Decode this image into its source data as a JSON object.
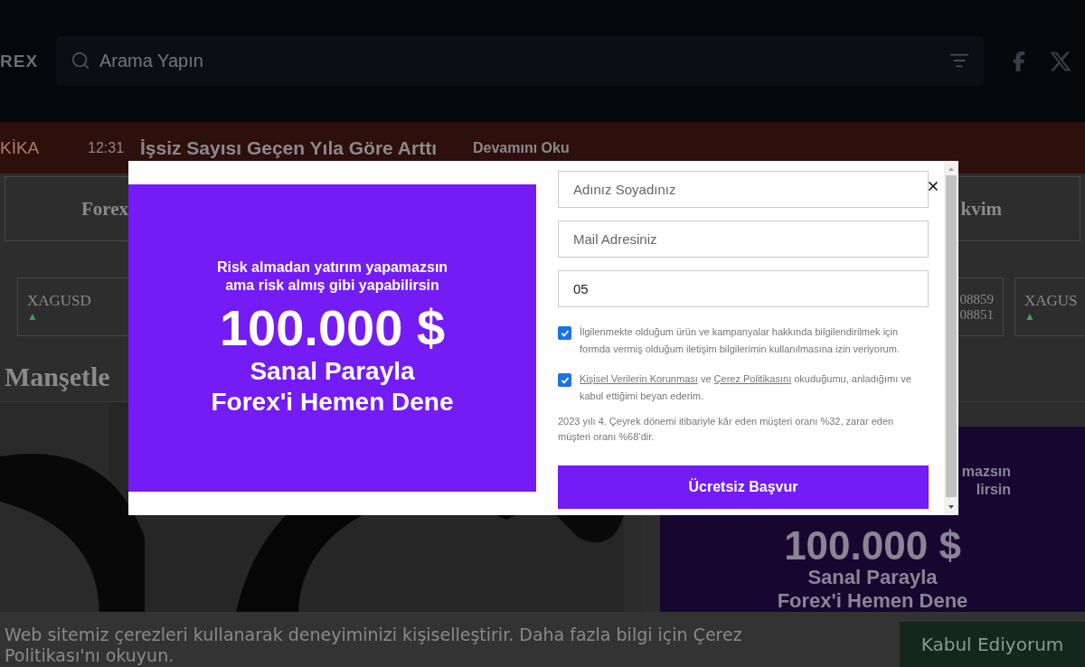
{
  "header": {
    "logo": "REX",
    "search": {
      "placeholder": "Arama Yapın"
    }
  },
  "breaking": {
    "label": "KİKA",
    "time": "12:31",
    "headline": "İşsiz Sayısı Geçen Yıla Göre Arttı",
    "link": "Devamını Oku"
  },
  "nav": [
    "Forex",
    "kvim"
  ],
  "tickers": [
    {
      "symbol": "XAGUSD",
      "trend": "▲"
    },
    {
      "values": [
        "08859",
        "08851"
      ]
    },
    {
      "symbol": "XAGUS",
      "trend": "▲"
    }
  ],
  "section_title": "Manşetle",
  "side_ad": {
    "tagline_lines": [
      "mazsın",
      "lirsin"
    ],
    "amount": "100.000 $",
    "title_lines": [
      "Sanal Parayla",
      "Forex'i Hemen Dene"
    ]
  },
  "cookie": {
    "text": "Web sitemiz çerezleri kullanarak deneyiminizi kişiselleştirir. Daha fazla bilgi için Çerez Politikası'nı okuyun.",
    "button": "Kabul Ediyorum"
  },
  "modal": {
    "promo": {
      "tagline_lines": [
        "Risk almadan yatırım yapamazsın",
        "ama risk almış gibi yapabilirsin"
      ],
      "amount": "100.000 $",
      "title_lines": [
        "Sanal Parayla",
        "Forex'i Hemen Dene"
      ]
    },
    "fields": [
      {
        "placeholder": "Adınız Soyadınız"
      },
      {
        "placeholder": "Mail Adresiniz"
      },
      {
        "value": "05"
      }
    ],
    "consents": [
      {
        "checked": true,
        "text": "İlgilenmekte olduğum ürün ve kampanyalar hakkında bilgilendirilmek için formda vermiş olduğum iletişim bilgilerimin kullanılmasına izin veriyorum."
      },
      {
        "checked": true,
        "links": [
          "Kişisel Verilerin Korunması",
          "Çerez Politikasını"
        ],
        "joiner": "ve",
        "text": "okuduğumu, anladığımı ve kabul ettiğimi beyan ederim."
      }
    ],
    "disclaimer": "2023 yılı 4. Çeyrek dönemi itibariyle kâr eden müşteri oranı %32, zarar eden müşteri oranı %68’dir.",
    "submit": "Ücretsiz Başvur"
  }
}
